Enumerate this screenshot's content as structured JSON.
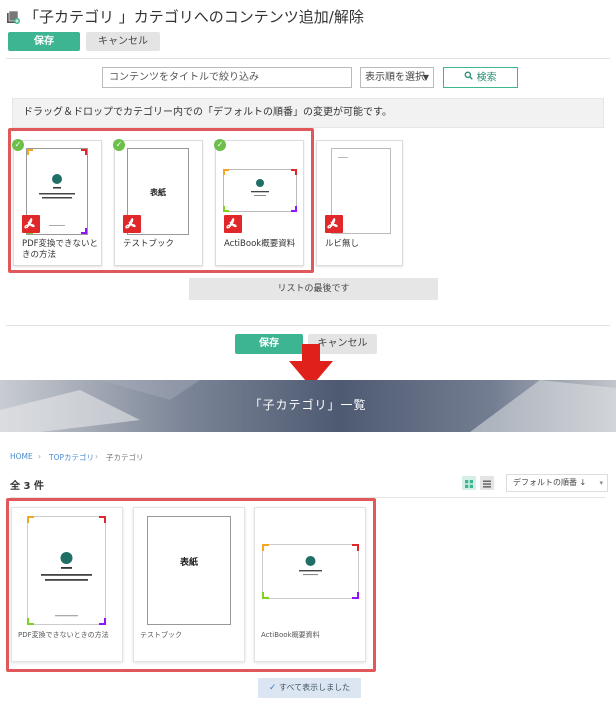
{
  "admin": {
    "title": "「子カテゴリ 」カテゴリへのコンテンツ追加/解除",
    "save_label": "保存",
    "cancel_label": "キャンセル",
    "search_placeholder": "コンテンツをタイトルで絞り込み",
    "sort_label": "表示順を選択",
    "search_button": "検索",
    "info_text": "ドラッグ＆ドロップでカテゴリー内での「デフォルトの順番」の変更が可能です。",
    "cards": [
      {
        "name": "PDF変換できないときの方法",
        "checked": true,
        "thumb": "acti"
      },
      {
        "name": "テストブック",
        "checked": true,
        "thumb": "cover"
      },
      {
        "name": "ActiBook概要資料",
        "checked": true,
        "thumb": "land"
      },
      {
        "name": "ルビ無し",
        "checked": false,
        "thumb": "blank"
      }
    ],
    "list_end": "リストの最後です",
    "cover_text": "表紙"
  },
  "banner": {
    "title": "「子カテゴリ」一覧"
  },
  "site": {
    "breadcrumb": [
      "HOME",
      "TOPカテゴリ",
      "子カテゴリ"
    ],
    "count_text": "全 3 件",
    "order_label": "デフォルトの順番 ↓",
    "cards": [
      {
        "name": "PDF変換できないときの方法",
        "thumb": "acti"
      },
      {
        "name": "テストブック",
        "thumb": "cover"
      },
      {
        "name": "ActiBook概要資料",
        "thumb": "land"
      }
    ],
    "all_shown": "すべて表示しました"
  },
  "colors": {
    "accent": "#3db593",
    "highlight": "#e0585a",
    "arrow": "#e0201b",
    "pdf": "#e0282a",
    "check": "#6cc04a"
  }
}
